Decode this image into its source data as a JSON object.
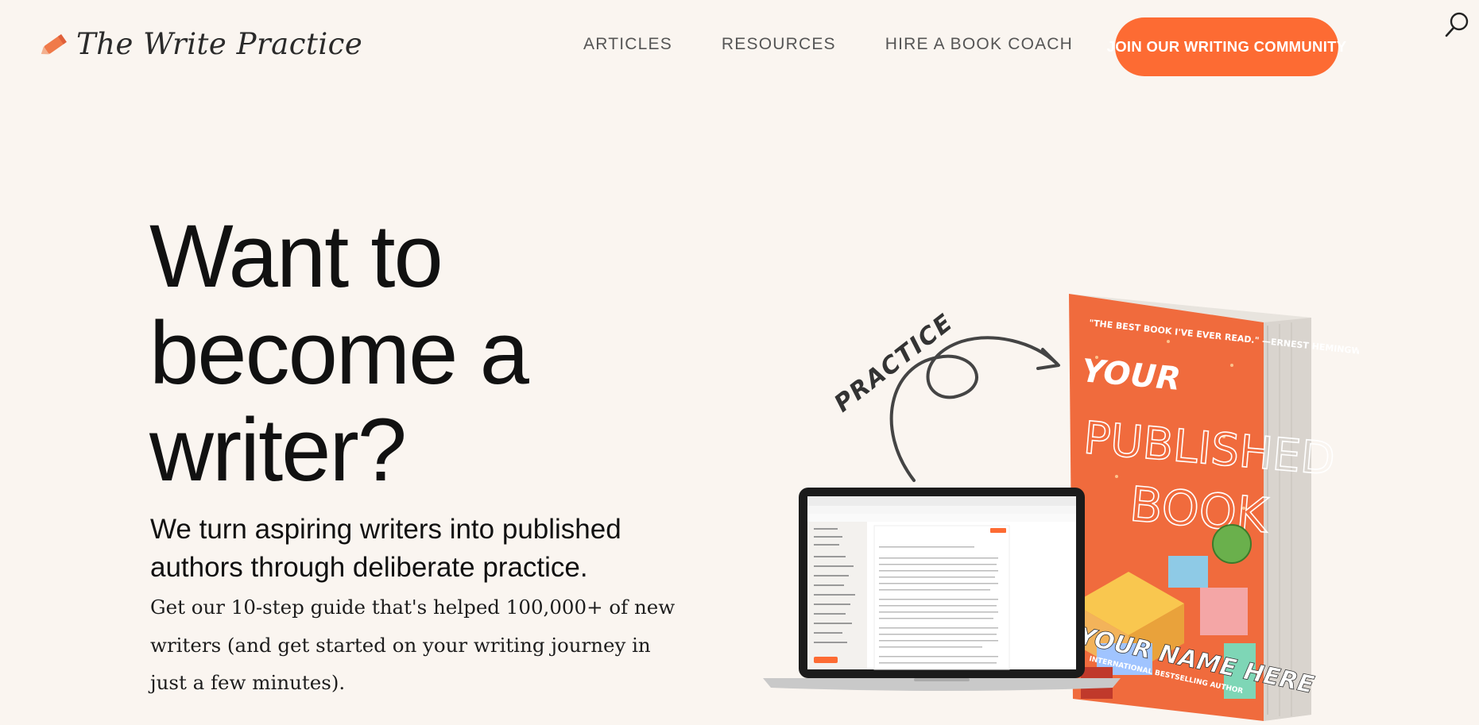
{
  "header": {
    "logo_text": "The Write Practice",
    "nav": [
      {
        "label": "ARTICLES"
      },
      {
        "label": "RESOURCES"
      },
      {
        "label": "HIRE A BOOK COACH"
      }
    ],
    "cta_label": "JOIN OUR WRITING COMMUNITY",
    "search_icon": "search-icon"
  },
  "hero": {
    "title": "Want to become a writer?",
    "subtitle": "We turn aspiring writers into published authors through deliberate practice.",
    "body": "Get our 10-step guide that's helped 100,000+ of new writers (and get started on your writing journey in just a few minutes)."
  },
  "illustration": {
    "arrow_label": "PRACTICE",
    "book": {
      "quote": "\"THE BEST BOOK I'VE EVER READ.\" —ERNEST HEMINGWAY",
      "title_line1": "YOUR",
      "title_line2": "PUBLISHED",
      "title_line3": "BOOK",
      "author": "YOUR NAME HERE",
      "tagline": "INTERNATIONAL BESTSELLING AUTHOR"
    },
    "laptop_icon": "laptop-screenshot"
  },
  "colors": {
    "background": "#faf5f0",
    "accent": "#fd6b33",
    "text": "#121212"
  }
}
